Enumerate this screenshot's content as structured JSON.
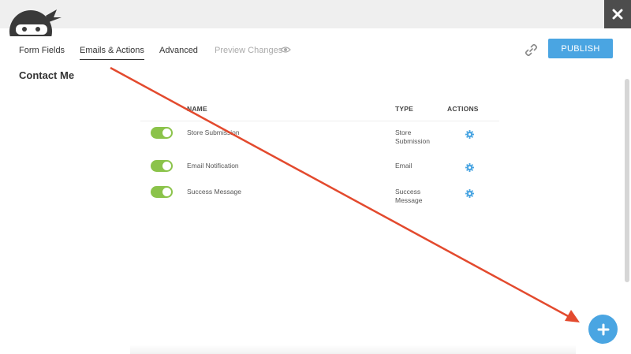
{
  "header": {
    "close_icon": "close-icon",
    "logo_icon": "ninja-logo-icon"
  },
  "tabs": [
    {
      "label": "Form Fields"
    },
    {
      "label": "Emails & Actions",
      "active": true
    },
    {
      "label": "Advanced"
    },
    {
      "label": "Preview Changes",
      "disabled": true
    }
  ],
  "toolbar": {
    "publish_label": "PUBLISH",
    "link_icon": "link-icon",
    "preview_icon": "eye-icon"
  },
  "form": {
    "title": "Contact Me"
  },
  "table": {
    "headers": {
      "name": "NAME",
      "type": "TYPE",
      "actions": "ACTIONS"
    },
    "rows": [
      {
        "enabled": true,
        "name": "Store Submission",
        "type": "Store Submission"
      },
      {
        "enabled": true,
        "name": "Email Notification",
        "type": "Email"
      },
      {
        "enabled": true,
        "name": "Success Message",
        "type": "Success Message"
      }
    ]
  },
  "colors": {
    "accent": "#4aa5e2",
    "toggle_on": "#8bc34a",
    "annotation_arrow": "#e34a2e"
  },
  "add_button_icon": "plus-icon"
}
